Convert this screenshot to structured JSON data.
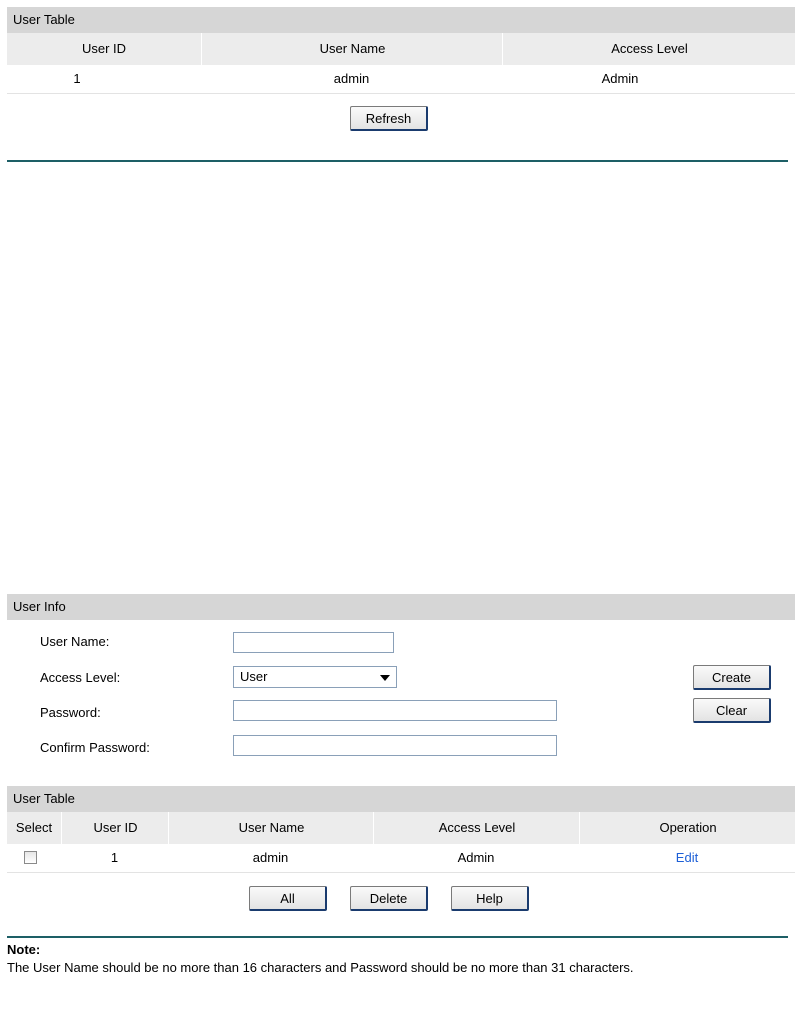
{
  "top_table": {
    "title": "User Table",
    "headers": [
      "User ID",
      "User Name",
      "Access Level"
    ],
    "rows": [
      [
        "1",
        "admin",
        "Admin"
      ]
    ],
    "refresh_label": "Refresh"
  },
  "user_info": {
    "title": "User Info",
    "user_name_label": "User Name:",
    "user_name_value": "",
    "access_level_label": "Access Level:",
    "access_level_value": "User",
    "password_label": "Password:",
    "password_value": "",
    "confirm_password_label": "Confirm Password:",
    "confirm_password_value": "",
    "create_label": "Create",
    "clear_label": "Clear"
  },
  "bottom_table": {
    "title": "User Table",
    "headers": [
      "Select",
      "User ID",
      "User Name",
      "Access Level",
      "Operation"
    ],
    "rows": [
      {
        "selected": false,
        "user_id": "1",
        "user_name": "admin",
        "access_level": "Admin",
        "operation": "Edit"
      }
    ],
    "all_label": "All",
    "delete_label": "Delete",
    "help_label": "Help"
  },
  "note": {
    "title": "Note:",
    "text": "The User Name should be no more than 16 characters and Password should be no more than 31 characters."
  }
}
